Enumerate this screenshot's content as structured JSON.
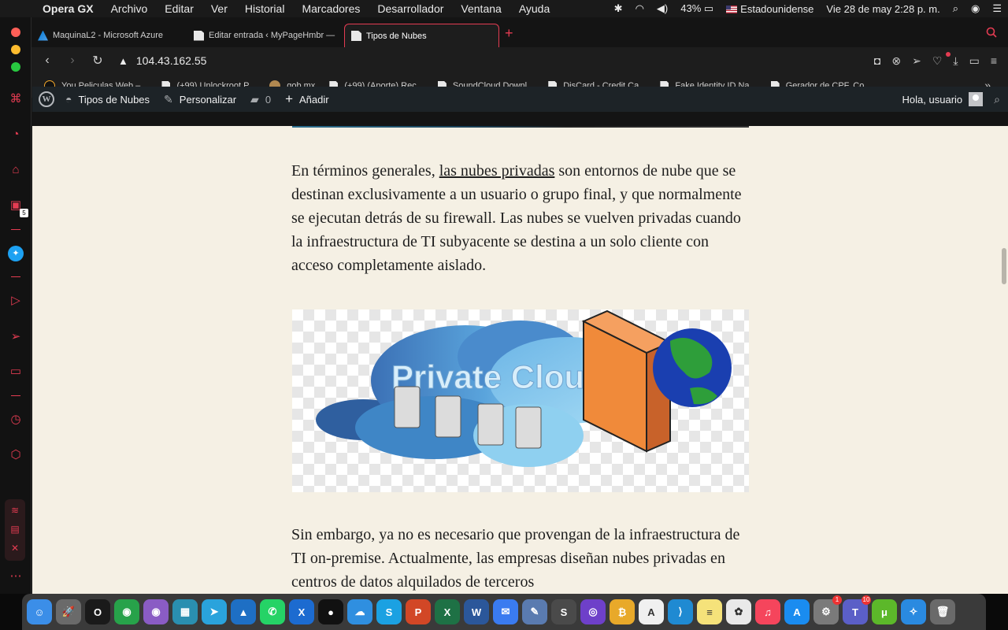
{
  "menubar": {
    "app_name": "Opera GX",
    "menus": [
      "Archivo",
      "Editar",
      "Ver",
      "Historial",
      "Marcadores",
      "Desarrollador",
      "Ventana",
      "Ayuda"
    ],
    "battery": "43%",
    "input_source": "Estadounidense",
    "datetime": "Vie 28 de may  2:28 p. m."
  },
  "tabs": [
    {
      "title": "MaquinaL2 - Microsoft Azure",
      "icon": "azure-icon",
      "active": false
    },
    {
      "title": "Editar entrada ‹ MyPageHmbr —",
      "icon": "page-icon",
      "active": false
    },
    {
      "title": "Tipos de Nubes",
      "icon": "page-icon",
      "active": true
    }
  ],
  "address": {
    "url": "104.43.162.55",
    "security": "not-secure-warning-icon"
  },
  "bookmarks": [
    {
      "label": "You Peliculas Web –...",
      "icon": "play-circle-icon"
    },
    {
      "label": "(+99) Unlockroot P...",
      "icon": "page-icon"
    },
    {
      "label": "gob.mx",
      "icon": "circle-favicon"
    },
    {
      "label": "(+99) (Aporte) Rec...",
      "icon": "page-icon"
    },
    {
      "label": "SoundCloud Downl...",
      "icon": "page-icon"
    },
    {
      "label": "DisCard - Credit Ca...",
      "icon": "page-icon"
    },
    {
      "label": "Fake Identity ID Na...",
      "icon": "page-icon"
    },
    {
      "label": "Gerador de CPF, Co...",
      "icon": "page-icon"
    }
  ],
  "wpbar": {
    "site_name": "Tipos de Nubes",
    "customize": "Personalizar",
    "comments_count": "0",
    "add_new": "Añadir",
    "greeting": "Hola, usuario"
  },
  "article": {
    "para1_before": "En términos generales, ",
    "para1_link": "las nubes privadas",
    "para1_after": " son entornos de nube que se destinan exclusivamente a un usuario o grupo final, y que normalmente se ejecutan detrás de su firewall. Las nubes se vuelven privadas cuando la infraestructura de TI subyacente se destina a un solo cliente con acceso completamente aislado.",
    "image_caption_text": "Private Cloud",
    "para2": "Sin embargo, ya no es necesario que provengan de la infraestructura de TI on-premise. Actualmente, las empresas diseñan nubes privadas en centros de datos alquilados de terceros"
  },
  "sidebar_badge": "5",
  "dock_apps": [
    {
      "name": "finder",
      "color": "#3b8ee8",
      "glyph": "☺"
    },
    {
      "name": "launchpad",
      "color": "#6a6a6a",
      "glyph": "🚀"
    },
    {
      "name": "opera-gx",
      "color": "#1a1a1a",
      "glyph": "O"
    },
    {
      "name": "app-green",
      "color": "#27a24a",
      "glyph": "◉"
    },
    {
      "name": "app-purple",
      "color": "#8a5cc4",
      "glyph": "◉"
    },
    {
      "name": "app-teal",
      "color": "#2a8fb0",
      "glyph": "▦"
    },
    {
      "name": "telegram",
      "color": "#2aa3dc",
      "glyph": "➤"
    },
    {
      "name": "app-blue",
      "color": "#1e6fc4",
      "glyph": "▲"
    },
    {
      "name": "whatsapp",
      "color": "#25d366",
      "glyph": "✆"
    },
    {
      "name": "xcode",
      "color": "#1c6bd0",
      "glyph": "X"
    },
    {
      "name": "app-black",
      "color": "#111111",
      "glyph": "●"
    },
    {
      "name": "cloud-app",
      "color": "#2f8fe0",
      "glyph": "☁"
    },
    {
      "name": "skype",
      "color": "#1ba1e2",
      "glyph": "S"
    },
    {
      "name": "powerpoint",
      "color": "#d24726",
      "glyph": "P"
    },
    {
      "name": "excel",
      "color": "#1e7145",
      "glyph": "X"
    },
    {
      "name": "word",
      "color": "#2b579a",
      "glyph": "W"
    },
    {
      "name": "messenger",
      "color": "#3a7bf0",
      "glyph": "✉"
    },
    {
      "name": "preview",
      "color": "#5a7bb0",
      "glyph": "✎"
    },
    {
      "name": "sublime",
      "color": "#4a4a4a",
      "glyph": "S"
    },
    {
      "name": "github",
      "color": "#6e40c9",
      "glyph": "◎"
    },
    {
      "name": "app-yellow",
      "color": "#e8a92a",
      "glyph": "₿"
    },
    {
      "name": "app-white",
      "color": "#f0f0f0",
      "glyph": "A"
    },
    {
      "name": "vscode",
      "color": "#1f8ad2",
      "glyph": "⟩"
    },
    {
      "name": "notes",
      "color": "#f5e27a",
      "glyph": "≡"
    },
    {
      "name": "photos",
      "color": "#e9e9e9",
      "glyph": "✿"
    },
    {
      "name": "music",
      "color": "#f5455c",
      "glyph": "♫"
    },
    {
      "name": "app-store",
      "color": "#1a8cf0",
      "glyph": "A"
    },
    {
      "name": "system-preferences",
      "color": "#7a7a7a",
      "glyph": "⚙",
      "badge": "1"
    },
    {
      "name": "teams",
      "color": "#5b5fc7",
      "glyph": "T",
      "badge": "10"
    },
    {
      "name": "utorrent",
      "color": "#5cb82a",
      "glyph": "μ"
    },
    {
      "name": "safari",
      "color": "#2a8ae0",
      "glyph": "✧"
    },
    {
      "name": "trash",
      "color": "#6a6a6a",
      "glyph": "🗑"
    }
  ],
  "colors": {
    "accent": "#e43c52",
    "wp_bar": "#1d2327",
    "page_bg": "#f5f0e4"
  }
}
